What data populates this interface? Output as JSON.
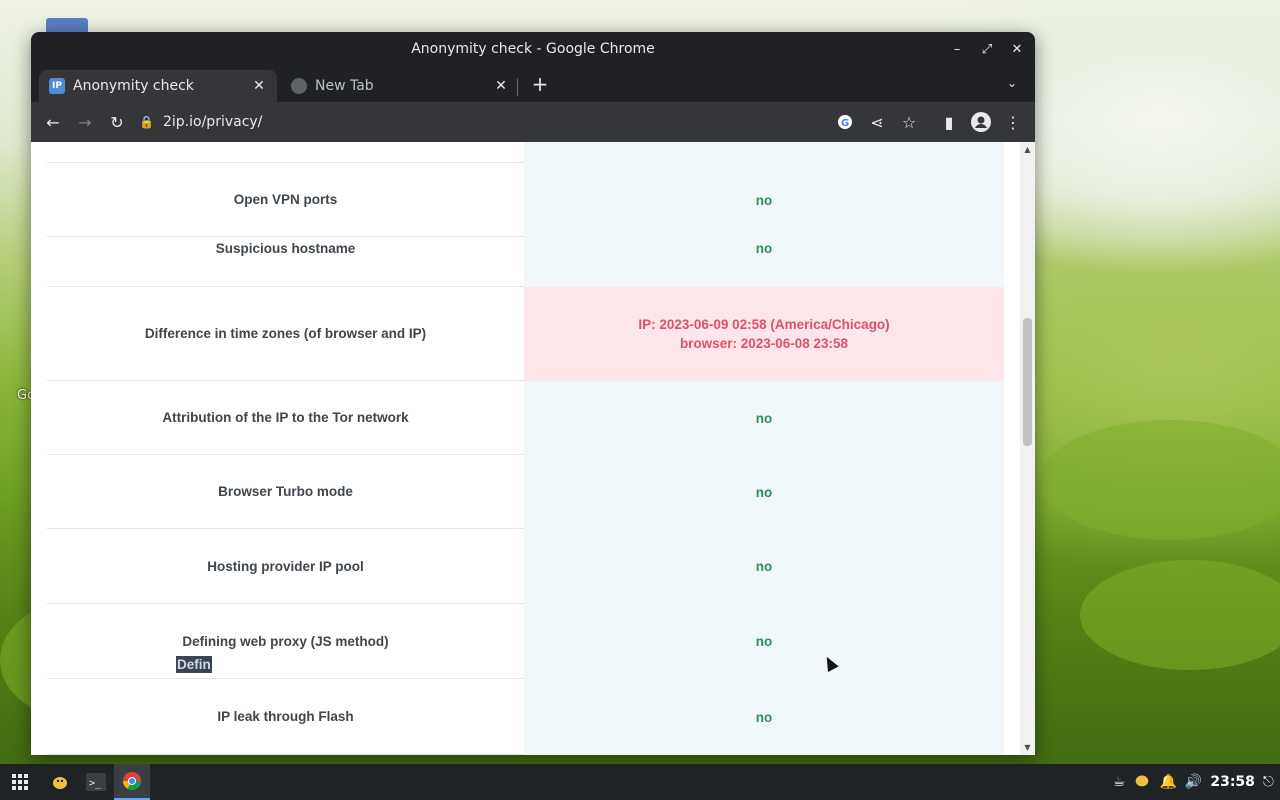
{
  "desktop": {
    "label_fragment": "Go"
  },
  "window": {
    "title": "Anonymity check - Google Chrome",
    "controls": {
      "minimize": "–",
      "maximize": "⤢",
      "close": "✕"
    }
  },
  "tabs": [
    {
      "label": "Anonymity check",
      "favicon": "IP",
      "active": true
    },
    {
      "label": "New Tab",
      "favicon": "",
      "active": false
    }
  ],
  "toolbar": {
    "url": "2ip.io/privacy/"
  },
  "checks": [
    {
      "label": "Open VPN ports",
      "value": "no",
      "status": "ok"
    },
    {
      "label": "Suspicious hostname",
      "value": "no",
      "status": "ok"
    },
    {
      "label": "Difference in time zones (of browser and IP)",
      "value_line1": "IP: 2023-06-09 02:58 (America/Chicago)",
      "value_line2": "browser: 2023-06-08 23:58",
      "status": "warn"
    },
    {
      "label": "Attribution of the IP to the Tor network",
      "value": "no",
      "status": "ok"
    },
    {
      "label": "Browser Turbo mode",
      "value": "no",
      "status": "ok"
    },
    {
      "label": "Hosting provider IP pool",
      "value": "no",
      "status": "ok"
    },
    {
      "label": "Defining web proxy (JS method)",
      "value": "no",
      "status": "ok"
    },
    {
      "label": "IP leak through Flash",
      "value": "no",
      "status": "ok"
    }
  ],
  "selection_fragment": "Defin",
  "taskbar": {
    "clock": "23:58"
  },
  "colors": {
    "ok": "#2e8e5c",
    "warn": "#e0506a",
    "value_bg": "#eff7fb",
    "warn_bg": "#fde6e9"
  }
}
